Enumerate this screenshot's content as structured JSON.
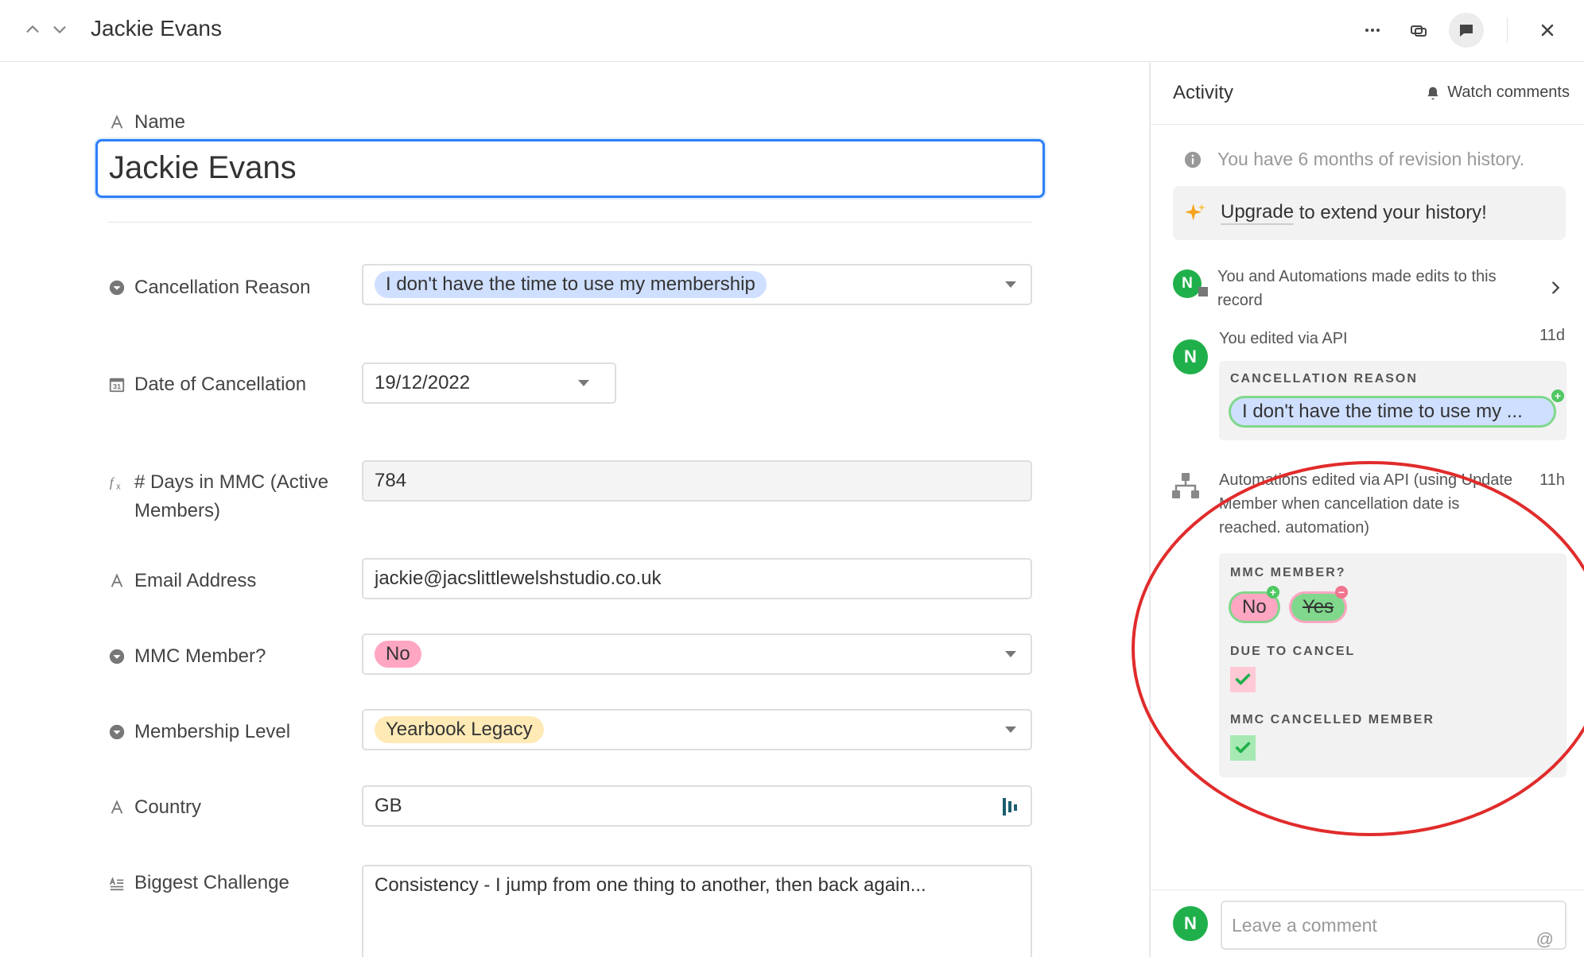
{
  "header": {
    "title": "Jackie Evans"
  },
  "form": {
    "name_label": "Name",
    "name_value": "Jackie Evans",
    "fields": {
      "cancellation_reason": {
        "label": "Cancellation Reason",
        "value": "I don't have the time to use my membership",
        "color": "#cfdfff"
      },
      "date_of_cancellation": {
        "label": "Date of Cancellation",
        "value": "19/12/2022"
      },
      "days_in_mmc": {
        "label": "# Days in MMC (Active Members)",
        "value": "784"
      },
      "email": {
        "label": "Email Address",
        "value": "jackie@jacslittlewelshstudio.co.uk"
      },
      "mmc_member": {
        "label": "MMC Member?",
        "value": "No",
        "color": "#ffa6c2"
      },
      "membership_level": {
        "label": "Membership Level",
        "value": "Yearbook Legacy",
        "color": "#ffeab6"
      },
      "country": {
        "label": "Country",
        "value": "GB"
      },
      "biggest_challenge": {
        "label": "Biggest Challenge",
        "value": "Consistency - I jump from one thing to another, then back again..."
      }
    }
  },
  "activity": {
    "title": "Activity",
    "watch_label": "Watch comments",
    "revision_info": "You have 6 months of revision history.",
    "upgrade_link": "Upgrade",
    "upgrade_rest": " to extend your history!",
    "summary": "You and Automations made edits to this record",
    "entries": [
      {
        "actor": "You edited via API",
        "time": "11d",
        "avatar": "N",
        "field_label": "CANCELLATION REASON",
        "added_value": "I don't have the time to use my ..."
      },
      {
        "actor": "Automations edited via API (using Update Member when cancellation date is reached. automation)",
        "time": "11h",
        "changes": {
          "mmc_label": "MMC MEMBER?",
          "mmc_added": "No",
          "mmc_removed": "Yes",
          "due_label": "DUE TO CANCEL",
          "cancelled_label": "MMC CANCELLED MEMBER"
        }
      }
    ],
    "comment_avatar": "N",
    "comment_placeholder": "Leave a comment",
    "at_symbol": "@"
  },
  "colors": {
    "accent": "#2d7ff9",
    "avatar": "#20b04b",
    "annotation": "#e12b2b"
  }
}
